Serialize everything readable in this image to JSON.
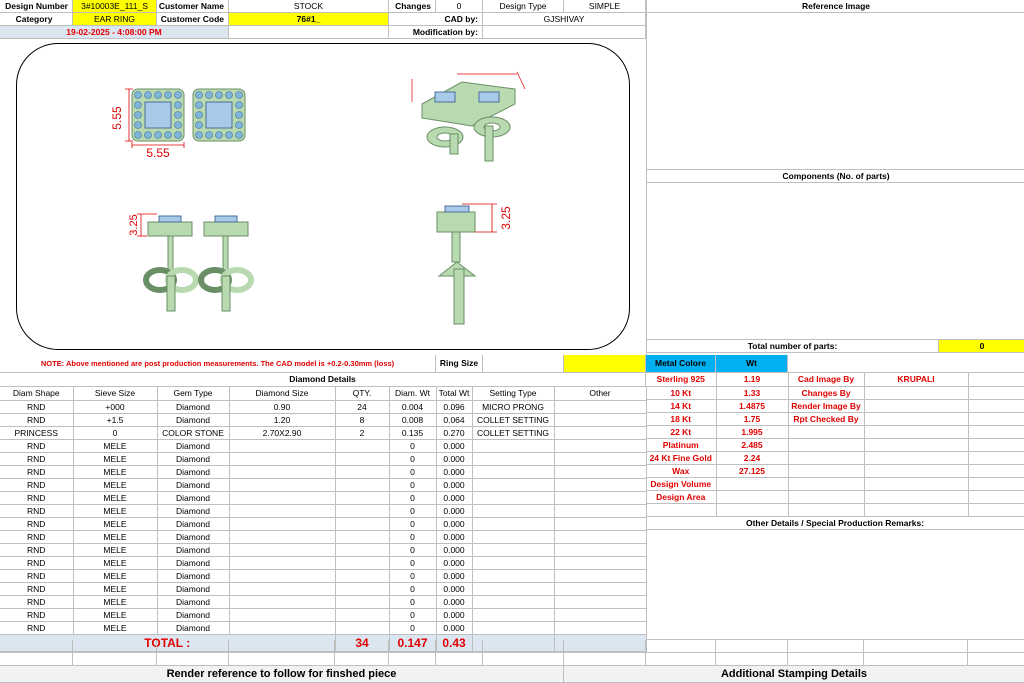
{
  "header": {
    "design_number_label": "Design Number",
    "design_number": "3#10003E_111_S",
    "customer_name_label": "Customer Name",
    "customer_name": "STOCK",
    "changes_label": "Changes",
    "changes": "0",
    "design_type_label": "Design Type",
    "design_type": "SIMPLE",
    "category_label": "Category",
    "category": "EAR RING",
    "customer_code_label": "Customer Code",
    "customer_code": "76#1_",
    "cad_by_label": "CAD by:",
    "cad_by": "GJSHIVAY",
    "date": "19-02-2025 - 4:08:00 PM",
    "modification_by_label": "Modification by:"
  },
  "reference_image_label": "Reference Image",
  "components_label": "Components (No. of parts)",
  "total_parts_label": "Total number of parts:",
  "total_parts": "0",
  "drawing": {
    "dim_top_width": "5.55",
    "dim_top_height": "5.55",
    "dim_front_left": "3.25",
    "dim_side": "3.25"
  },
  "note": "NOTE: Above mentioned are post production measurements. The CAD model is +0.2-0.30mm (loss)",
  "ring_size_label": "Ring Size",
  "diamond_details_label": "Diamond Details",
  "diamond_columns": [
    "Diam Shape",
    "Sieve Size",
    "Gem Type",
    "Diamond Size",
    "QTY.",
    "Diam. Wt",
    "Total Wt",
    "Setting Type",
    "Other"
  ],
  "diamond_rows": [
    [
      "RND",
      "+000",
      "Diamond",
      "0.90",
      "24",
      "0.004",
      "0.096",
      "MICRO PRONG",
      ""
    ],
    [
      "RND",
      "+1.5",
      "Diamond",
      "1.20",
      "8",
      "0.008",
      "0.064",
      "COLLET SETTING",
      ""
    ],
    [
      "PRINCESS",
      "0",
      "COLOR STONE",
      "2.70X2.90",
      "2",
      "0.135",
      "0.270",
      "COLLET SETTING",
      ""
    ],
    [
      "RND",
      "MELE",
      "Diamond",
      "",
      "",
      "0",
      "0.000",
      "",
      ""
    ],
    [
      "RND",
      "MELE",
      "Diamond",
      "",
      "",
      "0",
      "0.000",
      "",
      ""
    ],
    [
      "RND",
      "MELE",
      "Diamond",
      "",
      "",
      "0",
      "0.000",
      "",
      ""
    ],
    [
      "RND",
      "MELE",
      "Diamond",
      "",
      "",
      "0",
      "0.000",
      "",
      ""
    ],
    [
      "RND",
      "MELE",
      "Diamond",
      "",
      "",
      "0",
      "0.000",
      "",
      ""
    ],
    [
      "RND",
      "MELE",
      "Diamond",
      "",
      "",
      "0",
      "0.000",
      "",
      ""
    ],
    [
      "RND",
      "MELE",
      "Diamond",
      "",
      "",
      "0",
      "0.000",
      "",
      ""
    ],
    [
      "RND",
      "MELE",
      "Diamond",
      "",
      "",
      "0",
      "0.000",
      "",
      ""
    ],
    [
      "RND",
      "MELE",
      "Diamond",
      "",
      "",
      "0",
      "0.000",
      "",
      ""
    ],
    [
      "RND",
      "MELE",
      "Diamond",
      "",
      "",
      "0",
      "0.000",
      "",
      ""
    ],
    [
      "RND",
      "MELE",
      "Diamond",
      "",
      "",
      "0",
      "0.000",
      "",
      ""
    ],
    [
      "RND",
      "MELE",
      "Diamond",
      "",
      "",
      "0",
      "0.000",
      "",
      ""
    ],
    [
      "RND",
      "MELE",
      "Diamond",
      "",
      "",
      "0",
      "0.000",
      "",
      ""
    ],
    [
      "RND",
      "MELE",
      "Diamond",
      "",
      "",
      "0",
      "0.000",
      "",
      ""
    ],
    [
      "RND",
      "MELE",
      "Diamond",
      "",
      "",
      "0",
      "0.000",
      "",
      ""
    ]
  ],
  "totals": {
    "label": "TOTAL :",
    "qty": "34",
    "diam_wt": "0.147",
    "total_wt": "0.43"
  },
  "metal": {
    "header_label": "Metal Colore",
    "header_wt": "Wt",
    "rows": [
      {
        "name": "Sterling 925",
        "wt": "1.19"
      },
      {
        "name": "10 Kt",
        "wt": "1.33"
      },
      {
        "name": "14 Kt",
        "wt": "1.4875"
      },
      {
        "name": "18 Kt",
        "wt": "1.75"
      },
      {
        "name": "22 Kt",
        "wt": "1.995"
      },
      {
        "name": "Platinum",
        "wt": "2.485"
      },
      {
        "name": "24 Kt Fine Gold",
        "wt": "2.24"
      },
      {
        "name": "Wax",
        "wt": "27.125"
      },
      {
        "name": "Design Volume",
        "wt": ""
      },
      {
        "name": "Design Area",
        "wt": ""
      }
    ]
  },
  "credits": [
    {
      "label": "Cad Image By",
      "value": "KRUPALI"
    },
    {
      "label": "Changes By",
      "value": ""
    },
    {
      "label": "Render Image By",
      "value": ""
    },
    {
      "label": "Rpt Checked By",
      "value": ""
    }
  ],
  "other_details_label": "Other Details / Special Production Remarks:",
  "render_reference_label": "Render reference to follow for finshed piece",
  "stamping_label": "Additional Stamping Details",
  "colors": {
    "yellow": "#ffff00",
    "light_blue": "#dce6f1",
    "cyan": "#00b0f0",
    "red": "#e00000",
    "metal_green": "#b9d9b0",
    "stone_blue": "#7fb5d8"
  }
}
